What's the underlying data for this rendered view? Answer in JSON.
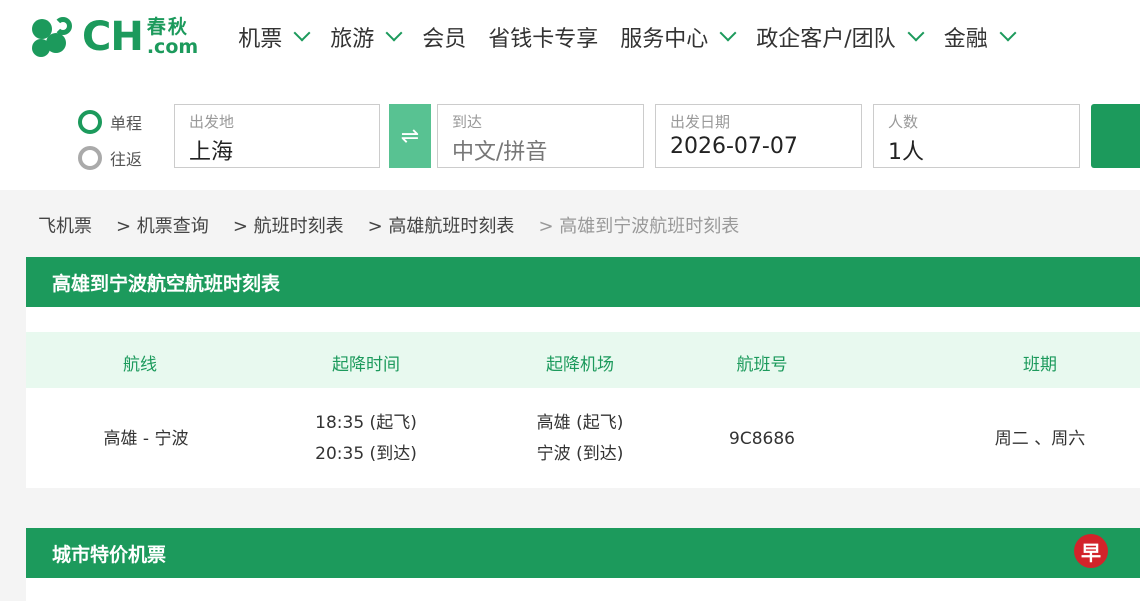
{
  "brand": {
    "ch": "CH",
    "cn": "春秋",
    "com": ".com"
  },
  "nav": [
    {
      "label": "机票",
      "has_menu": true
    },
    {
      "label": "旅游",
      "has_menu": true
    },
    {
      "label": "会员",
      "has_menu": false
    },
    {
      "label": "省钱卡专享",
      "has_menu": false
    },
    {
      "label": "服务中心",
      "has_menu": true
    },
    {
      "label": "政企客户/团队",
      "has_menu": true
    },
    {
      "label": "金融",
      "has_menu": true
    }
  ],
  "search": {
    "trip_types": [
      {
        "label": "单程",
        "selected": true
      },
      {
        "label": "往返",
        "selected": false
      }
    ],
    "from": {
      "label": "出发地",
      "value": "上海"
    },
    "to": {
      "label": "到达",
      "placeholder": "中文/拼音"
    },
    "date": {
      "label": "出发日期",
      "value": "2026-07-07"
    },
    "passengers": {
      "label": "人数",
      "value": "1人"
    },
    "swap_icon": "⇌"
  },
  "breadcrumb": [
    "飞机票",
    "> 机票查询",
    "> 航班时刻表",
    "> 高雄航班时刻表",
    "> 高雄到宁波航班时刻表"
  ],
  "timetable": {
    "title": "高雄到宁波航空航班时刻表",
    "columns": [
      "航线",
      "起降时间",
      "起降机场",
      "航班号",
      "班期"
    ],
    "rows": [
      {
        "route": "高雄 - 宁波",
        "dep_time": "18:35 (起飞)",
        "arr_time": "20:35 (到达)",
        "dep_airport": "高雄 (起飞)",
        "arr_airport": "宁波 (到达)",
        "flight_no": "9C8686",
        "days": "周二 、周六"
      }
    ]
  },
  "deals": {
    "title": "城市特价机票"
  },
  "watermark": {
    "text": "早",
    "color": "#d2232a"
  },
  "colors": {
    "brand": "#1c9a5c",
    "swap": "#58c292",
    "table_head_bg": "#e8f9ef"
  }
}
